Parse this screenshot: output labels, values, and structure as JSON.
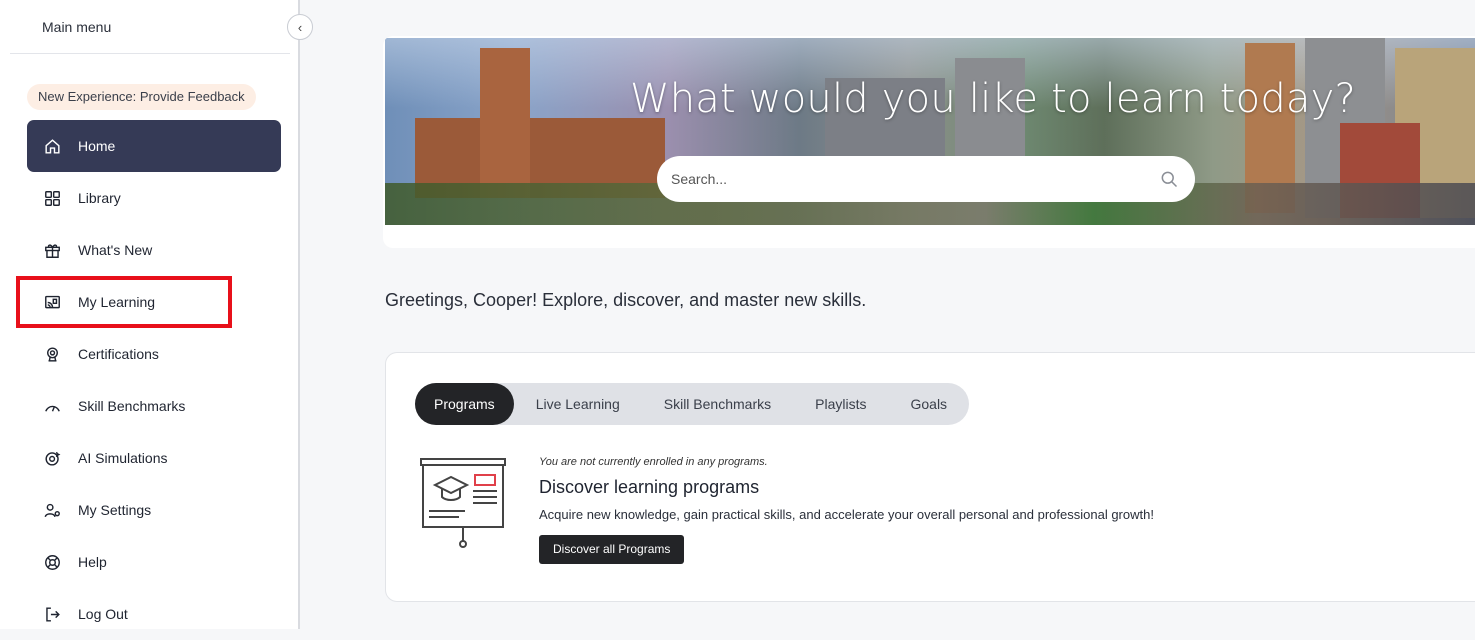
{
  "sidebar": {
    "menu_title": "Main menu",
    "feedback_label": "New Experience: Provide Feedback",
    "items": [
      {
        "label": "Home"
      },
      {
        "label": "Library"
      },
      {
        "label": "What's New"
      },
      {
        "label": "My Learning"
      },
      {
        "label": "Certifications"
      },
      {
        "label": "Skill Benchmarks"
      },
      {
        "label": "AI Simulations"
      },
      {
        "label": "My Settings"
      },
      {
        "label": "Help"
      },
      {
        "label": "Log Out"
      }
    ],
    "active_item": "Home",
    "highlighted_item": "My Learning"
  },
  "hero": {
    "title": "What would you like to learn today?",
    "search_placeholder": "Search..."
  },
  "main": {
    "greeting": "Greetings, Cooper! Explore, discover, and master new skills.",
    "tabs": [
      {
        "label": "Programs"
      },
      {
        "label": "Live Learning"
      },
      {
        "label": "Skill Benchmarks"
      },
      {
        "label": "Playlists"
      },
      {
        "label": "Goals"
      }
    ],
    "active_tab": "Programs",
    "programs": {
      "not_enrolled": "You are not currently enrolled in any programs.",
      "title": "Discover learning programs",
      "description": "Acquire new knowledge, gain practical skills, and accelerate your overall personal and professional growth!",
      "button_label": "Discover all Programs"
    }
  },
  "colors": {
    "active_nav_bg": "#353a56",
    "highlight_border": "#e8101a",
    "feedback_pill_bg": "#fdeee4",
    "tab_active_bg": "#232427",
    "tab_track_bg": "#dfe1e6"
  },
  "icons": {
    "collapse": "chevron-left-icon",
    "home": "home-icon",
    "library": "grid-icon",
    "whats_new": "gift-icon",
    "my_learning": "cast-screen-icon",
    "certifications": "award-icon",
    "skill_benchmarks": "gauge-icon",
    "ai_simulations": "ai-target-icon",
    "my_settings": "user-settings-icon",
    "help": "lifebuoy-icon",
    "log_out": "logout-icon",
    "search": "search-icon"
  }
}
